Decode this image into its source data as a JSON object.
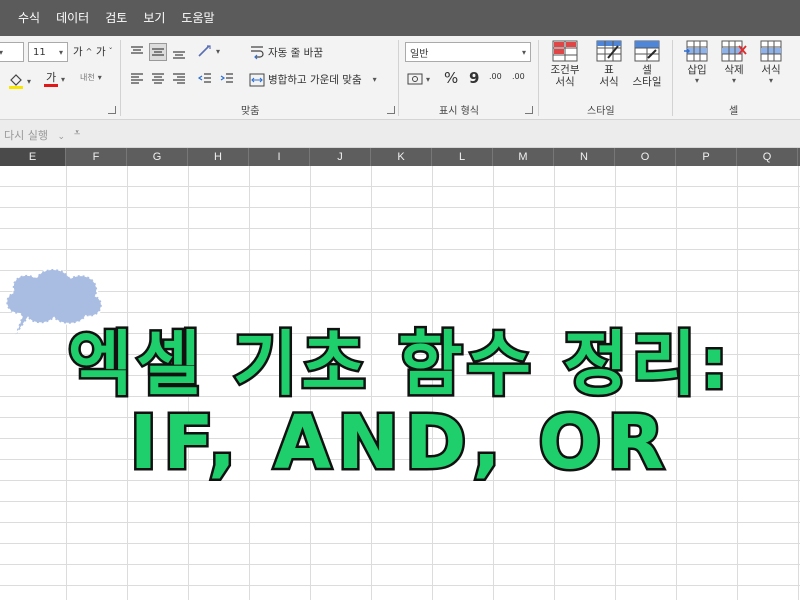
{
  "menu": {
    "tabs": [
      "수식",
      "데이터",
      "검토",
      "보기",
      "도움말"
    ]
  },
  "ribbon": {
    "font": {
      "size_value": "11",
      "grow_label": "가",
      "shrink_label": "가",
      "fill_label": "가",
      "phonetic_label": "내천"
    },
    "alignment": {
      "wrap_label": "자동 줄 바꿈",
      "merge_label": "병합하고 가운데 맞춤",
      "group_label": "맞춤"
    },
    "number": {
      "format_value": "일반",
      "percent_symbol": "%",
      "comma_symbol": "9",
      "inc_decimal": ".00",
      "dec_decimal": ".00",
      "group_label": "표시 형식"
    },
    "styles": {
      "conditional_label": "조건부\n서식",
      "table_label": "표\n서식",
      "cell_styles_label": "셀\n스타일",
      "group_label": "스타일"
    },
    "cells": {
      "insert_label": "삽입",
      "delete_label": "삭제",
      "format_label": "서식",
      "group_label": "셀"
    }
  },
  "formula_bar": {
    "hint": "다시 실행"
  },
  "columns": [
    "E",
    "F",
    "G",
    "H",
    "I",
    "J",
    "K",
    "L",
    "M",
    "N",
    "O",
    "P",
    "Q"
  ],
  "overlay": {
    "line1": "엑셀 기초 함수 정리:",
    "line2": "IF, AND, OR"
  },
  "colors": {
    "menubar_bg": "#5b5b5b",
    "ribbon_bg": "#f3f3f3",
    "headline_fill": "#1ecf6c",
    "headline_stroke": "#111111",
    "bubble_fill": "#a9bde3"
  }
}
